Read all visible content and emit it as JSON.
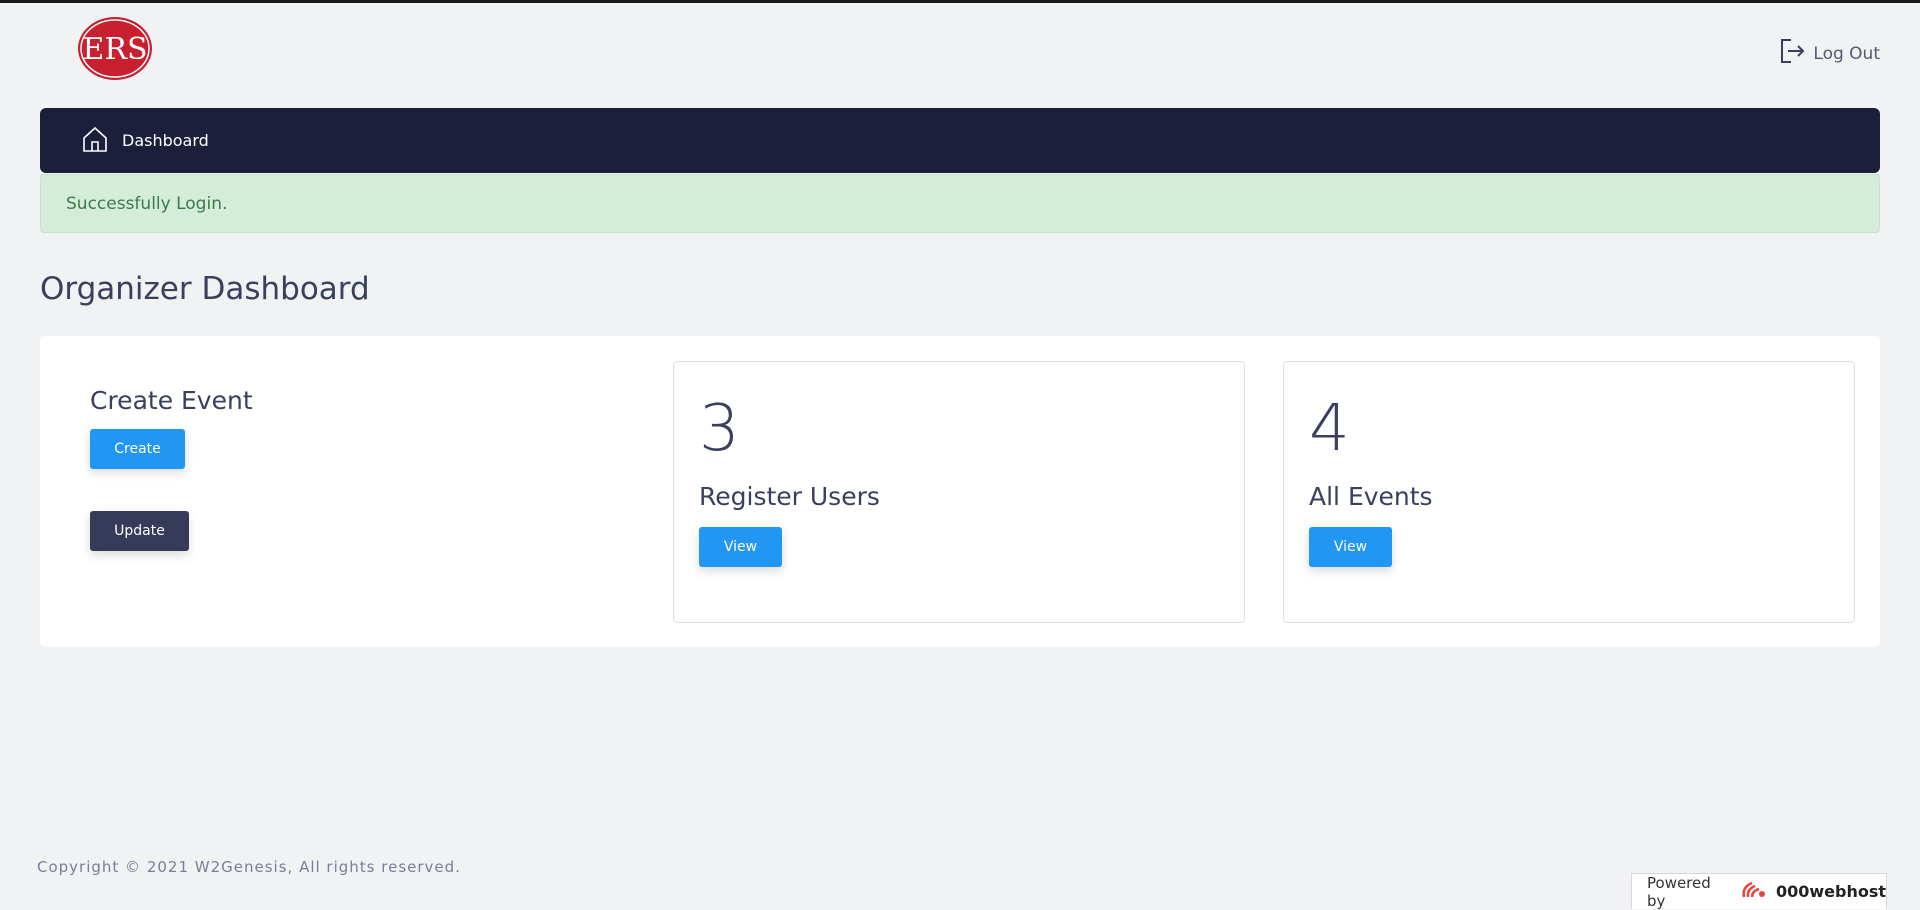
{
  "header": {
    "logo_text": "ERS",
    "logout_label": "Log Out"
  },
  "nav": {
    "dashboard_label": "Dashboard"
  },
  "alert": {
    "message": "Successfully Login."
  },
  "page": {
    "title": "Organizer Dashboard"
  },
  "create_section": {
    "title": "Create Event",
    "create_label": "Create",
    "update_label": "Update"
  },
  "stats": {
    "users": {
      "count": "3",
      "label": "Register Users",
      "button_label": "View"
    },
    "events": {
      "count": "4",
      "label": "All Events",
      "button_label": "View"
    }
  },
  "footer": {
    "copyright": "Copyright © 2021 W2Genesis, All rights reserved."
  },
  "powered_by": {
    "label": "Powered by",
    "brand": "000webhost"
  },
  "colors": {
    "navbar": "#1b1f3c",
    "primary_button": "#2196f3",
    "dark_button": "#363b5a",
    "alert_bg": "#d4edda",
    "logo_red": "#c8202f"
  },
  "icons": {
    "logo": "ers-logo",
    "logout": "logout-icon",
    "dashboard": "home-icon",
    "powered": "webhost-logo-icon"
  }
}
